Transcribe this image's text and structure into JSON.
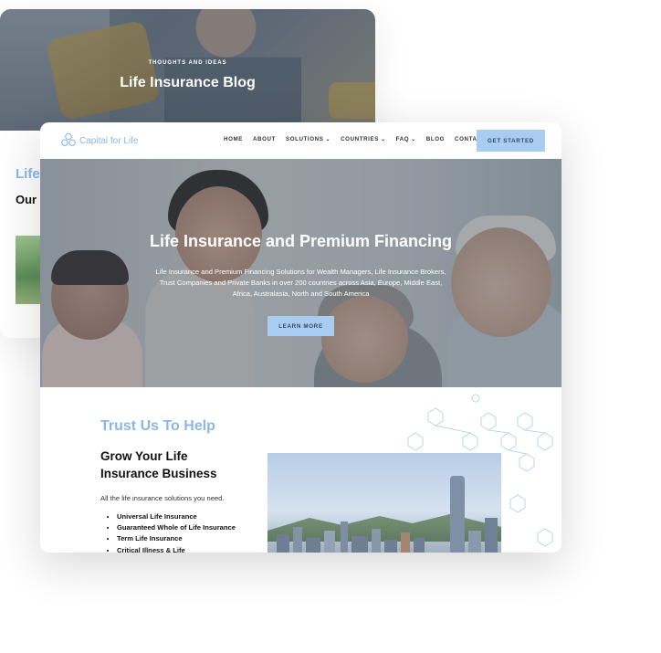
{
  "blog": {
    "eyebrow": "THOUGHTS AND IDEAS",
    "title": "Life Insurance Blog",
    "heading": "Life",
    "subheading": "Our I"
  },
  "header": {
    "logo_text": "Capital for Life",
    "menu": [
      {
        "label": "HOME",
        "has_dropdown": false
      },
      {
        "label": "ABOUT",
        "has_dropdown": false
      },
      {
        "label": "SOLUTIONS",
        "has_dropdown": true
      },
      {
        "label": "COUNTRIES",
        "has_dropdown": true
      },
      {
        "label": "FAQ",
        "has_dropdown": true
      },
      {
        "label": "BLOG",
        "has_dropdown": false
      },
      {
        "label": "CONTACT",
        "has_dropdown": false
      }
    ],
    "chevron": "⌄",
    "cta_label": "GET STARTED"
  },
  "hero": {
    "title": "Life Insurance and Premium Financing",
    "text": "Life Insurance and Premium Financing Solutions for Wealth Managers, Life Insurance Brokers, Trust Companies and Private Banks in over 200 countries across Asia, Europe, Middle East, Africa, Australasia, North and South America",
    "button_label": "LEARN MORE"
  },
  "section": {
    "title": "Trust Us To Help",
    "heading": "Grow Your Life Insurance Business",
    "intro": "All the life insurance solutions you need.",
    "items": [
      "Universal Life Insurance",
      "Guaranteed Whole of Life Insurance",
      "Term Life Insurance",
      "Critical Illness & Life"
    ]
  },
  "colors": {
    "accent": "#8ab8e6",
    "button": "#a9cdf2"
  }
}
